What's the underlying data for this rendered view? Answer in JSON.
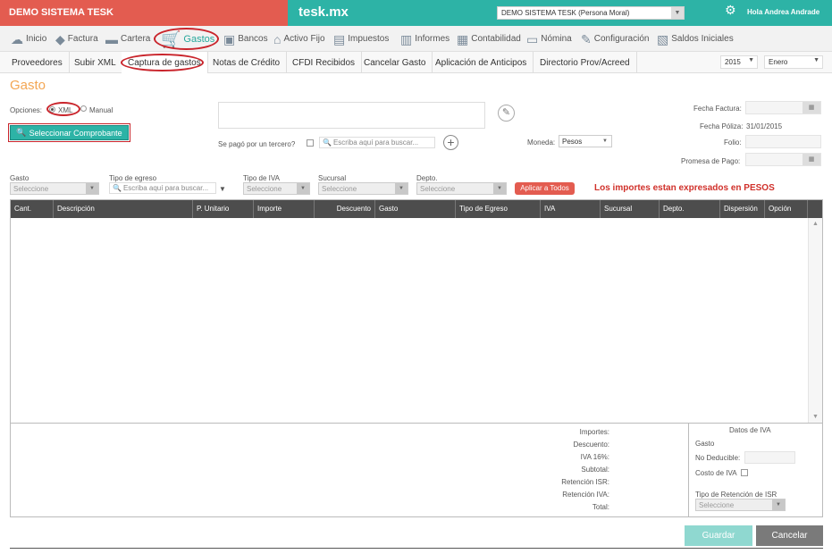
{
  "header": {
    "company_name": "DEMO SISTEMA TESK",
    "brand": "tesk.mx",
    "company_selector": "DEMO SISTEMA TESK (Persona Moral)",
    "greeting": "Hola Andrea Andrade",
    "colors": {
      "brand_teal": "#2db3a6",
      "company_red": "#e35c50",
      "accent_orange": "#f3a653",
      "highlight_red": "#c9242b"
    }
  },
  "main_menu": {
    "items": [
      {
        "label": "Inicio",
        "icon": "cloud-icon"
      },
      {
        "label": "Factura",
        "icon": "tag-icon"
      },
      {
        "label": "Cartera",
        "icon": "wallet-icon"
      },
      {
        "label": "Gastos",
        "icon": "cart-icon",
        "active": true
      },
      {
        "label": "Bancos",
        "icon": "bank-icon"
      },
      {
        "label": "Activo Fijo",
        "icon": "house-icon"
      },
      {
        "label": "Impuestos",
        "icon": "briefcase-icon"
      },
      {
        "label": "Informes",
        "icon": "document-icon"
      },
      {
        "label": "Contabilidad",
        "icon": "ledger-icon"
      },
      {
        "label": "Nómina",
        "icon": "card-icon"
      },
      {
        "label": "Configuración",
        "icon": "wrench-icon"
      },
      {
        "label": "Saldos Iniciales",
        "icon": "balance-icon"
      }
    ]
  },
  "sub_menu": {
    "items": [
      {
        "label": "Proveedores"
      },
      {
        "label": "Subir XML"
      },
      {
        "label": "Captura de gastos",
        "active": true
      },
      {
        "label": "Notas de Crédito"
      },
      {
        "label": "CFDI Recibidos"
      },
      {
        "label": "Cancelar Gasto"
      },
      {
        "label": "Aplicación de Anticipos"
      },
      {
        "label": "Directorio Prov/Acreed"
      }
    ],
    "year": "2015",
    "month": "Enero"
  },
  "form": {
    "title": "Gasto",
    "options_label": "Opciones:",
    "option_xml": "XML",
    "option_manual": "Manual",
    "select_voucher_button": "Seleccionar Comprobante",
    "third_party_label": "Se pagó por un tercero?",
    "third_party_search_placeholder": "Escriba aquí para buscar...",
    "currency_label": "Moneda:",
    "currency_value": "Pesos",
    "invoice_date_label": "Fecha Factura:",
    "policy_date_label": "Fecha Póliza:",
    "policy_date_value": "31/01/2015",
    "folio_label": "Folio:",
    "payment_promise_label": "Promesa de Pago:",
    "filters": {
      "gasto_label": "Gasto",
      "gasto_value": "Seleccione",
      "egreso_label": "Tipo de egreso",
      "egreso_placeholder": "Escriba aquí para buscar...",
      "iva_label": "Tipo de IVA",
      "iva_value": "Seleccione",
      "sucursal_label": "Sucursal",
      "sucursal_value": "Seleccione",
      "depto_label": "Depto.",
      "depto_value": "Seleccione"
    },
    "apply_all_button": "Aplicar a Todos",
    "currency_notice": "Los importes estan expresados en PESOS"
  },
  "table": {
    "columns": [
      "Cant.",
      "Descripción",
      "P. Unitario",
      "Importe",
      "Descuento",
      "Gasto",
      "Tipo de Egreso",
      "IVA",
      "Sucursal",
      "Depto.",
      "Dispersión",
      "Opción"
    ],
    "rows": []
  },
  "totals": {
    "importes": "Importes:",
    "descuento": "Descuento:",
    "iva": "IVA 16%:",
    "subtotal": "Subtotal:",
    "retencion_isr": "Retención ISR:",
    "retencion_iva": "Retención IVA:",
    "total": "Total:"
  },
  "iva_panel": {
    "title": "Datos de IVA",
    "gasto_label": "Gasto",
    "no_deducible_label": "No Deducible:",
    "costo_iva_label": "Costo de IVA",
    "retention_type_label": "Tipo de Retención de ISR",
    "retention_type_value": "Seleccione"
  },
  "actions": {
    "save": "Guardar",
    "cancel": "Cancelar"
  }
}
